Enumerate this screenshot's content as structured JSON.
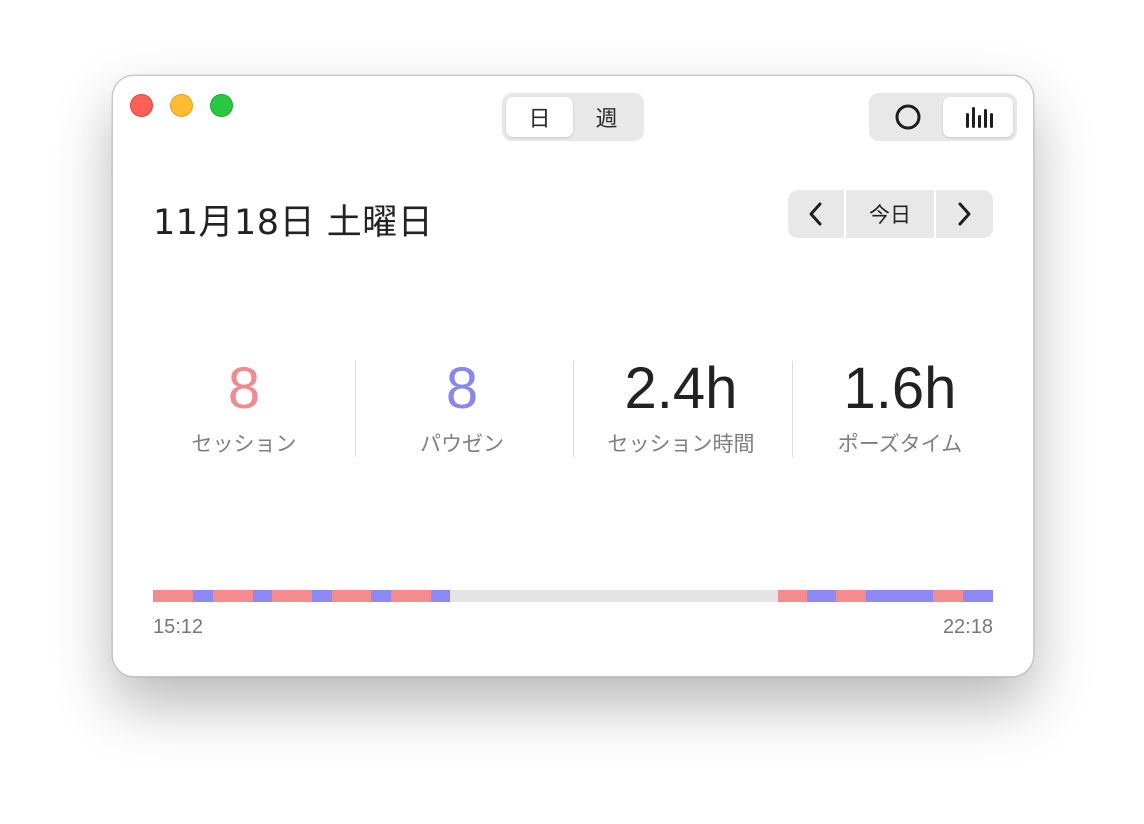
{
  "window": {
    "controls": [
      "close",
      "minimize",
      "zoom"
    ]
  },
  "period_toggle": {
    "options": [
      "日",
      "週"
    ],
    "selected": "日"
  },
  "view_toggle": {
    "options": [
      "circle-icon",
      "bar-chart-icon"
    ],
    "selected": "bar-chart-icon"
  },
  "date_title": "11月18日 土曜日",
  "navigation": {
    "prev_icon": "chevron-left-icon",
    "today_label": "今日",
    "next_icon": "chevron-right-icon"
  },
  "stats": [
    {
      "value": "8",
      "label": "セッション",
      "color": "#f08a8e"
    },
    {
      "value": "8",
      "label": "パウゼン",
      "color": "#8a86ee"
    },
    {
      "value": "2.4h",
      "label": "セッション時間",
      "color": "#222222"
    },
    {
      "value": "1.6h",
      "label": "ポーズタイム",
      "color": "#222222"
    }
  ],
  "timeline": {
    "start_label": "15:12",
    "end_label": "22:18",
    "colors": {
      "session": "#f48b8e",
      "pause": "#8c89f2"
    },
    "blocks": [
      {
        "kind": "session",
        "start": 0.0,
        "end": 0.048
      },
      {
        "kind": "pause",
        "start": 0.048,
        "end": 0.071
      },
      {
        "kind": "session",
        "start": 0.071,
        "end": 0.119
      },
      {
        "kind": "pause",
        "start": 0.119,
        "end": 0.142
      },
      {
        "kind": "session",
        "start": 0.142,
        "end": 0.189
      },
      {
        "kind": "pause",
        "start": 0.189,
        "end": 0.213
      },
      {
        "kind": "session",
        "start": 0.213,
        "end": 0.26
      },
      {
        "kind": "pause",
        "start": 0.26,
        "end": 0.283
      },
      {
        "kind": "session",
        "start": 0.283,
        "end": 0.331
      },
      {
        "kind": "pause",
        "start": 0.331,
        "end": 0.354
      },
      {
        "kind": "session",
        "start": 0.744,
        "end": 0.778
      },
      {
        "kind": "pause",
        "start": 0.778,
        "end": 0.813
      },
      {
        "kind": "session",
        "start": 0.813,
        "end": 0.849
      },
      {
        "kind": "pause",
        "start": 0.849,
        "end": 0.929
      },
      {
        "kind": "session",
        "start": 0.929,
        "end": 0.964
      },
      {
        "kind": "pause",
        "start": 0.964,
        "end": 1.0
      }
    ]
  }
}
